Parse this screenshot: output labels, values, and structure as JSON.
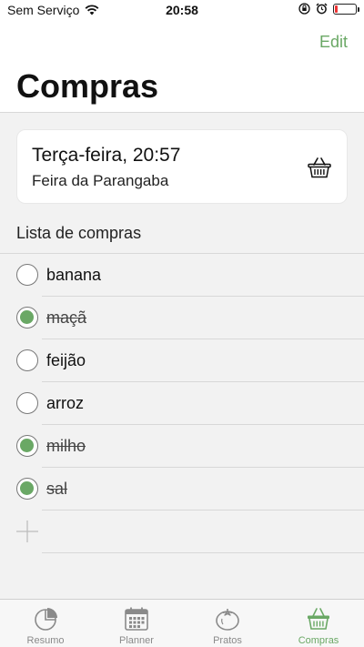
{
  "status_bar": {
    "carrier": "Sem Serviço",
    "time": "20:58",
    "wifi_icon": "wifi-icon",
    "battery_level": 0.1
  },
  "header": {
    "edit_label": "Edit",
    "title": "Compras"
  },
  "trip": {
    "date": "Terça-feira, 20:57",
    "place": "Feira da Parangaba",
    "icon": "basket-icon"
  },
  "list": {
    "section_label": "Lista de compras",
    "items": [
      {
        "label": "banana",
        "checked": false
      },
      {
        "label": "maçã",
        "checked": true
      },
      {
        "label": "feijão",
        "checked": false
      },
      {
        "label": "arroz",
        "checked": false
      },
      {
        "label": "milho",
        "checked": true
      },
      {
        "label": "sal",
        "checked": true
      }
    ]
  },
  "tabs": [
    {
      "label": "Resumo",
      "icon": "pie-chart-icon",
      "active": false
    },
    {
      "label": "Planner",
      "icon": "calendar-icon",
      "active": false
    },
    {
      "label": "Pratos",
      "icon": "tomato-icon",
      "active": false
    },
    {
      "label": "Compras",
      "icon": "basket-icon",
      "active": true
    }
  ],
  "colors": {
    "accent": "#6aa865",
    "battery_low": "#e33333"
  }
}
